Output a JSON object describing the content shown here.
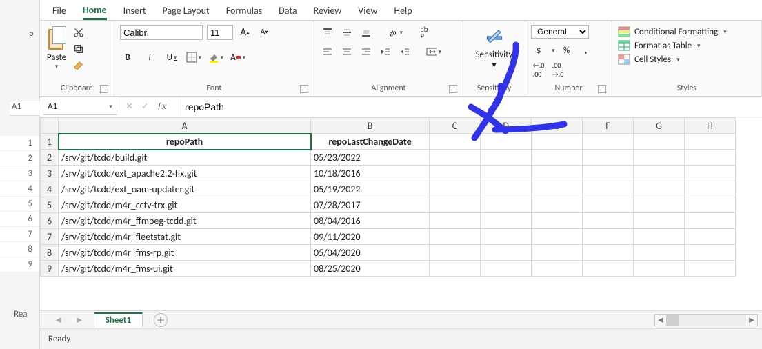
{
  "tabs": [
    "File",
    "Home",
    "Insert",
    "Page Layout",
    "Formulas",
    "Data",
    "Review",
    "View",
    "Help"
  ],
  "active_tab": "Home",
  "ribbon": {
    "clipboard": {
      "paste": "Paste",
      "label": "Clipboard"
    },
    "font": {
      "name": "Calibri",
      "size": "11",
      "bold": "B",
      "italic": "I",
      "underline": "U",
      "grow": "A",
      "shrink": "A",
      "label": "Font"
    },
    "alignment": {
      "wrap": "ab",
      "label": "Alignment"
    },
    "sensitivity": {
      "label": "Sensitivity",
      "btn": "Sensitivity"
    },
    "number": {
      "format": "General",
      "dollar": "$",
      "percent": "%",
      "comma": ",",
      "inc": ".00",
      "dec": ".0",
      "label": "Number"
    },
    "styles": {
      "cond": "Conditional Formatting",
      "table": "Format as Table",
      "cell": "Cell Styles",
      "label": "Styles"
    }
  },
  "namebox": "A1",
  "fx_value": "repoPath",
  "columns": [
    "A",
    "B",
    "C",
    "D",
    "E",
    "F",
    "G",
    "H"
  ],
  "rows": [
    {
      "n": "1",
      "a": "repoPath",
      "b": "repoLastChangeDate"
    },
    {
      "n": "2",
      "a": "/srv/git/tcdd/build.git",
      "b": "05/23/2022"
    },
    {
      "n": "3",
      "a": "/srv/git/tcdd/ext_apache2.2-fix.git",
      "b": "10/18/2016"
    },
    {
      "n": "4",
      "a": "/srv/git/tcdd/ext_oam-updater.git",
      "b": "05/19/2022"
    },
    {
      "n": "5",
      "a": "/srv/git/tcdd/m4r_cctv-trx.git",
      "b": "07/28/2017"
    },
    {
      "n": "6",
      "a": "/srv/git/tcdd/m4r_ffmpeg-tcdd.git",
      "b": "08/04/2016"
    },
    {
      "n": "7",
      "a": "/srv/git/tcdd/m4r_fleetstat.git",
      "b": "09/11/2020"
    },
    {
      "n": "8",
      "a": "/srv/git/tcdd/m4r_fms-rp.git",
      "b": "05/04/2020"
    },
    {
      "n": "9",
      "a": "/srv/git/tcdd/m4r_fms-ui.git",
      "b": "08/25/2020"
    }
  ],
  "sheet_tab": "Sheet1",
  "status": "Ready",
  "leftstub": {
    "cell": "A1",
    "p": "P",
    "rea": "Rea"
  }
}
